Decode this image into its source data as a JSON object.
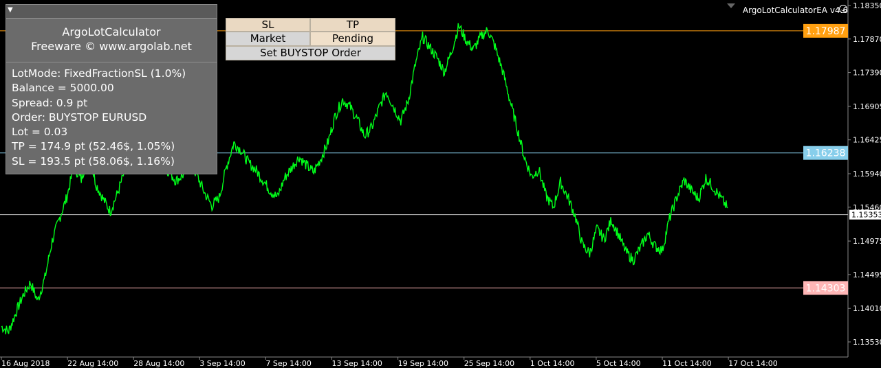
{
  "window": {
    "ea_label": "ArgoLotCalculatorEA v4.6",
    "smile_icon": "smiley-icon"
  },
  "info_panel": {
    "title": "ArgoLotCalculator",
    "subtitle": "Freeware © www.argolab.net",
    "lines": [
      "LotMode: FixedFractionSL (1.0%)",
      "Balance = 5000.00",
      "Spread: 0.9 pt",
      "Order: BUYSTOP EURUSD",
      "Lot = 0.03",
      "TP = 174.9 pt (52.46$, 1.05%)",
      "SL = 193.5 pt (58.06$, 1.16%)"
    ]
  },
  "buttons": {
    "sl": "SL",
    "tp": "TP",
    "market": "Market",
    "pending": "Pending",
    "set_order": "Set BUYSTOP Order"
  },
  "colors": {
    "background": "#000000",
    "price_line": "#00ff1a",
    "tp_line": "#ff9f10",
    "entry_line": "#87ceeb",
    "sl_line": "#ffb6b6",
    "current_line": "#c8c8c8"
  },
  "chart_data": {
    "type": "line",
    "symbol": "EURUSD",
    "x_ticks": [
      "16 Aug 2018",
      "22 Aug 14:00",
      "28 Aug 14:00",
      "3 Sep 14:00",
      "7 Sep 14:00",
      "13 Sep 14:00",
      "19 Sep 14:00",
      "25 Sep 14:00",
      "1 Oct 14:00",
      "5 Oct 14:00",
      "11 Oct 14:00",
      "17 Oct 14:00"
    ],
    "y_ticks": [
      "1.18350",
      "1.17870",
      "1.17390",
      "1.16905",
      "1.16425",
      "1.15940",
      "1.15460",
      "1.14975",
      "1.14495",
      "1.14010",
      "1.13530"
    ],
    "ylim": [
      1.1353,
      1.1835
    ],
    "levels": {
      "tp": "1.17987",
      "entry": "1.16238",
      "current": "1.15353",
      "sl": "1.14303"
    },
    "series": [
      {
        "x": [
          0,
          0.01,
          0.02,
          0.03,
          0.04,
          0.05,
          0.06,
          0.07,
          0.08,
          0.09,
          0.1,
          0.11,
          0.12,
          0.13,
          0.14,
          0.15,
          0.16,
          0.17,
          0.18,
          0.19,
          0.2,
          0.21,
          0.22,
          0.23,
          0.24,
          0.25,
          0.26,
          0.27,
          0.28,
          0.29,
          0.3,
          0.31,
          0.32,
          0.33,
          0.34,
          0.35,
          0.36,
          0.37,
          0.38,
          0.39,
          0.4,
          0.41,
          0.42,
          0.43,
          0.44,
          0.45,
          0.46,
          0.47,
          0.48,
          0.49,
          0.5,
          0.51,
          0.52,
          0.53,
          0.54,
          0.55,
          0.56,
          0.57,
          0.58,
          0.59,
          0.6,
          0.61,
          0.62,
          0.63,
          0.64,
          0.65,
          0.66,
          0.67,
          0.68,
          0.69,
          0.7,
          0.71,
          0.72,
          0.73,
          0.74,
          0.75,
          0.76,
          0.77,
          0.78,
          0.79,
          0.8,
          0.81,
          0.82,
          0.83,
          0.84,
          0.85,
          0.86,
          0.87,
          0.88,
          0.89,
          0.9,
          0.91,
          0.92,
          0.93,
          0.94,
          0.95,
          0.96,
          0.97,
          0.98,
          0.99,
          1.0
        ],
        "y": [
          1.1375,
          1.1368,
          1.1395,
          1.142,
          1.1438,
          1.1412,
          1.1445,
          1.1498,
          1.153,
          1.156,
          1.1605,
          1.1585,
          1.1625,
          1.158,
          1.1558,
          1.154,
          1.1566,
          1.1598,
          1.1625,
          1.164,
          1.165,
          1.1618,
          1.1605,
          1.1598,
          1.1584,
          1.1592,
          1.161,
          1.159,
          1.1566,
          1.1548,
          1.156,
          1.1604,
          1.1638,
          1.1628,
          1.161,
          1.16,
          1.1585,
          1.157,
          1.156,
          1.1588,
          1.1603,
          1.1618,
          1.1606,
          1.1596,
          1.1616,
          1.164,
          1.1678,
          1.17,
          1.169,
          1.1672,
          1.1648,
          1.166,
          1.1688,
          1.1712,
          1.169,
          1.167,
          1.1698,
          1.175,
          1.179,
          1.1775,
          1.176,
          1.174,
          1.177,
          1.1806,
          1.1785,
          1.1772,
          1.179,
          1.18,
          1.1775,
          1.1742,
          1.17,
          1.166,
          1.1618,
          1.159,
          1.16,
          1.1562,
          1.1546,
          1.1582,
          1.156,
          1.1534,
          1.1492,
          1.148,
          1.1515,
          1.15,
          1.1528,
          1.1506,
          1.1482,
          1.147,
          1.1488,
          1.1508,
          1.149,
          1.1484,
          1.153,
          1.156,
          1.1585,
          1.157,
          1.1558,
          1.1588,
          1.1575,
          1.156,
          1.1545
        ]
      }
    ]
  }
}
